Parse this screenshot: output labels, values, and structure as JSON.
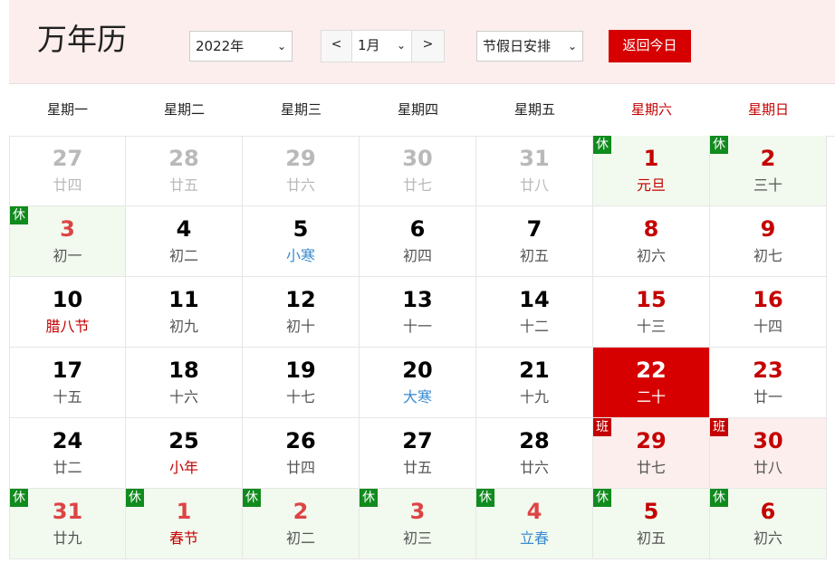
{
  "header": {
    "title": "万年历",
    "year": "2022年",
    "prev": "<",
    "month": "1月",
    "next": ">",
    "holiday_select": "节假日安排",
    "today_button": "返回今日"
  },
  "weekdays": [
    "星期一",
    "星期二",
    "星期三",
    "星期四",
    "星期五",
    "星期六",
    "星期日"
  ],
  "badges": {
    "rest": "休",
    "work": "班"
  },
  "colors": {
    "accent": "#d70000",
    "holiday_bg": "#f2faef",
    "workday_bg": "#fbeeec",
    "rest_badge": "#108b1d",
    "term": "#3a8ad0"
  },
  "rows": [
    [
      {
        "day": "27",
        "lunar": "廿四",
        "state": "other"
      },
      {
        "day": "28",
        "lunar": "廿五",
        "state": "other"
      },
      {
        "day": "29",
        "lunar": "廿六",
        "state": "other"
      },
      {
        "day": "30",
        "lunar": "廿七",
        "state": "other"
      },
      {
        "day": "31",
        "lunar": "廿八",
        "state": "other"
      },
      {
        "day": "1",
        "lunar": "元旦",
        "state": "holiday",
        "badge": "rest",
        "num_color": "red",
        "lunar_color": "festival"
      },
      {
        "day": "2",
        "lunar": "三十",
        "state": "holiday",
        "badge": "rest",
        "num_color": "red"
      }
    ],
    [
      {
        "day": "3",
        "lunar": "初一",
        "state": "holiday",
        "badge": "rest",
        "num_color": "redlight"
      },
      {
        "day": "4",
        "lunar": "初二"
      },
      {
        "day": "5",
        "lunar": "小寒",
        "lunar_color": "term"
      },
      {
        "day": "6",
        "lunar": "初四"
      },
      {
        "day": "7",
        "lunar": "初五"
      },
      {
        "day": "8",
        "lunar": "初六",
        "num_color": "red"
      },
      {
        "day": "9",
        "lunar": "初七",
        "num_color": "red"
      }
    ],
    [
      {
        "day": "10",
        "lunar": "腊八节",
        "lunar_color": "festival"
      },
      {
        "day": "11",
        "lunar": "初九"
      },
      {
        "day": "12",
        "lunar": "初十"
      },
      {
        "day": "13",
        "lunar": "十一"
      },
      {
        "day": "14",
        "lunar": "十二"
      },
      {
        "day": "15",
        "lunar": "十三",
        "num_color": "red"
      },
      {
        "day": "16",
        "lunar": "十四",
        "num_color": "red"
      }
    ],
    [
      {
        "day": "17",
        "lunar": "十五"
      },
      {
        "day": "18",
        "lunar": "十六"
      },
      {
        "day": "19",
        "lunar": "十七"
      },
      {
        "day": "20",
        "lunar": "大寒",
        "lunar_color": "term"
      },
      {
        "day": "21",
        "lunar": "十九"
      },
      {
        "day": "22",
        "lunar": "二十",
        "state": "today"
      },
      {
        "day": "23",
        "lunar": "廿一",
        "num_color": "red"
      }
    ],
    [
      {
        "day": "24",
        "lunar": "廿二"
      },
      {
        "day": "25",
        "lunar": "小年",
        "lunar_color": "festival"
      },
      {
        "day": "26",
        "lunar": "廿四"
      },
      {
        "day": "27",
        "lunar": "廿五"
      },
      {
        "day": "28",
        "lunar": "廿六"
      },
      {
        "day": "29",
        "lunar": "廿七",
        "state": "work",
        "badge": "work",
        "num_color": "red"
      },
      {
        "day": "30",
        "lunar": "廿八",
        "state": "work",
        "badge": "work",
        "num_color": "red"
      }
    ],
    [
      {
        "day": "31",
        "lunar": "廿九",
        "state": "holiday",
        "badge": "rest",
        "num_color": "redlight"
      },
      {
        "day": "1",
        "lunar": "春节",
        "state": "holiday",
        "badge": "rest",
        "num_color": "redlight",
        "lunar_color": "festival"
      },
      {
        "day": "2",
        "lunar": "初二",
        "state": "holiday",
        "badge": "rest",
        "num_color": "redlight"
      },
      {
        "day": "3",
        "lunar": "初三",
        "state": "holiday",
        "badge": "rest",
        "num_color": "redlight"
      },
      {
        "day": "4",
        "lunar": "立春",
        "state": "holiday",
        "badge": "rest",
        "num_color": "redlight",
        "lunar_color": "term"
      },
      {
        "day": "5",
        "lunar": "初五",
        "state": "holiday",
        "badge": "rest",
        "num_color": "red"
      },
      {
        "day": "6",
        "lunar": "初六",
        "state": "holiday",
        "badge": "rest",
        "num_color": "red"
      }
    ]
  ]
}
